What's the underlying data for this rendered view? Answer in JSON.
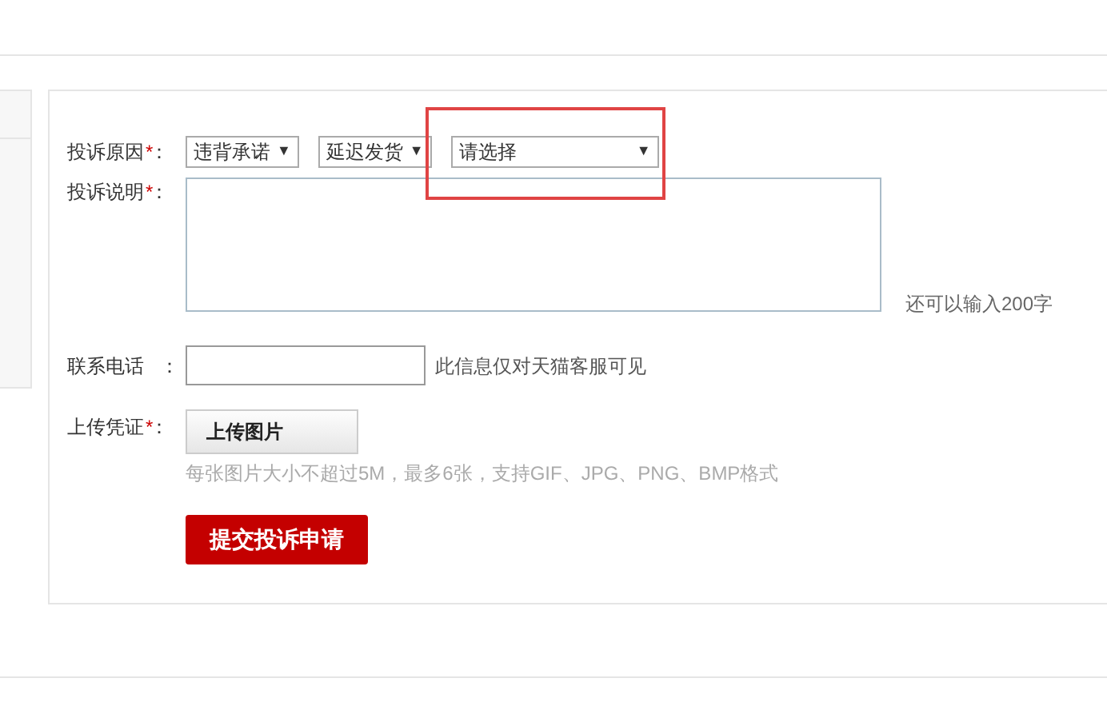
{
  "form": {
    "reason": {
      "label": "投诉原因",
      "required_mark": "*",
      "colon": "：",
      "selects": [
        {
          "value": "违背承诺",
          "caret": "▼"
        },
        {
          "value": "延迟发货",
          "caret": "▼"
        },
        {
          "value": "请选择",
          "caret": "▼",
          "highlighted": true
        }
      ]
    },
    "description": {
      "label": "投诉说明",
      "required_mark": "*",
      "colon": "：",
      "counter": "还可以输入200字"
    },
    "phone": {
      "label": "联系电话",
      "colon": "：",
      "note": "此信息仅对天猫客服可见"
    },
    "evidence": {
      "label": "上传凭证",
      "required_mark": "*",
      "colon": "：",
      "button": "上传图片",
      "hint": "每张图片大小不超过5M，最多6张，支持GIF、JPG、PNG、BMP格式"
    },
    "submit": "提交投诉申请"
  }
}
